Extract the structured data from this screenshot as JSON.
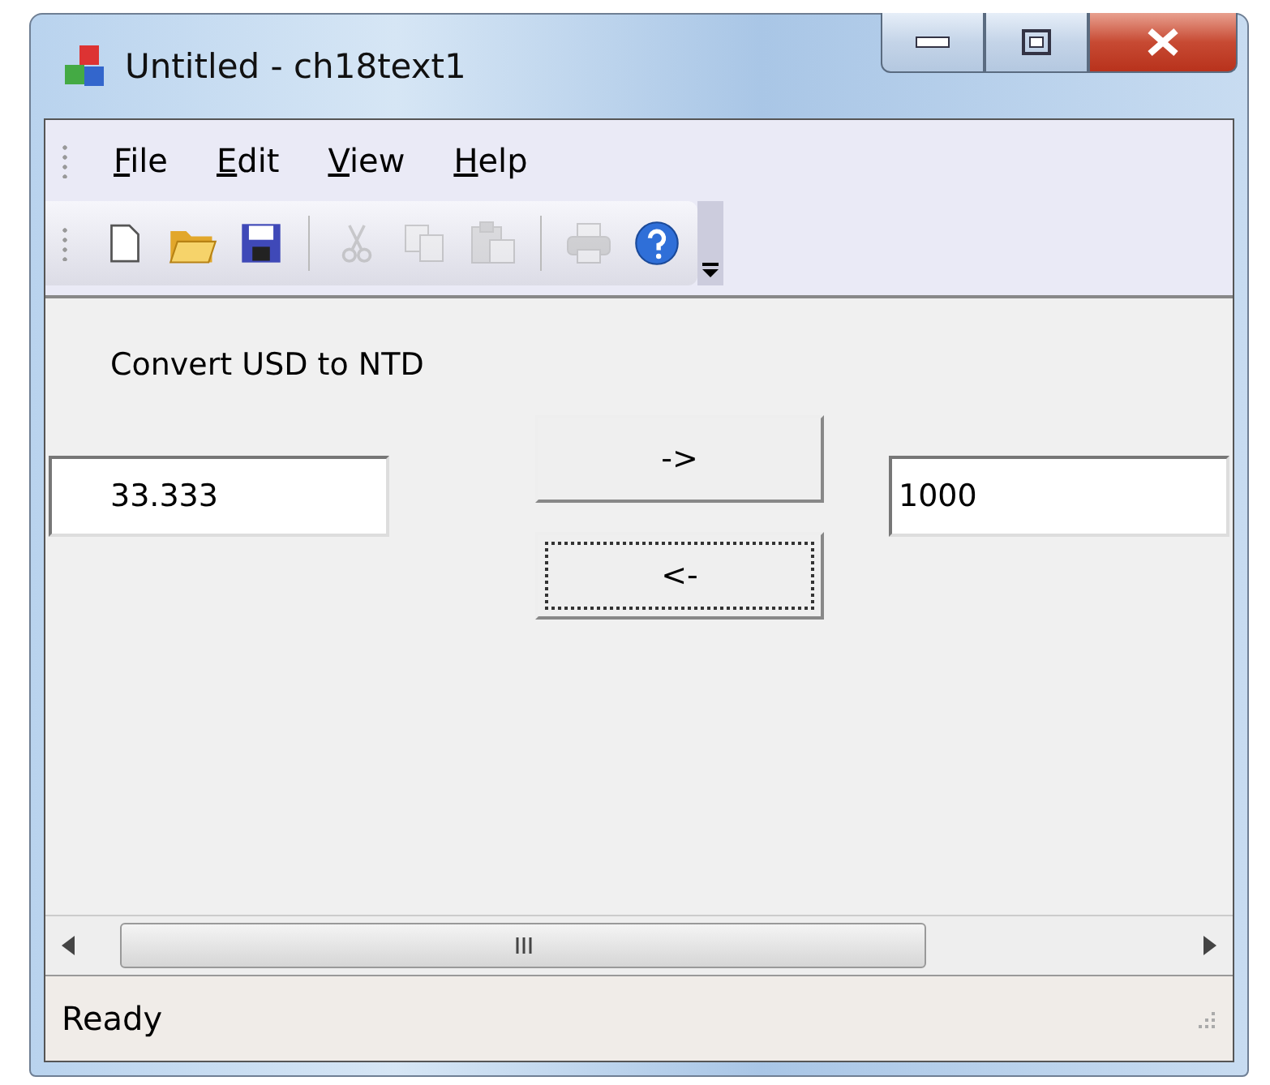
{
  "window": {
    "title": "Untitled - ch18text1"
  },
  "menu": [
    {
      "label": "File"
    },
    {
      "label": "Edit"
    },
    {
      "label": "View"
    },
    {
      "label": "Help"
    }
  ],
  "toolbar": [
    {
      "kind": "new",
      "disabled": false
    },
    {
      "kind": "open",
      "disabled": false
    },
    {
      "kind": "save",
      "disabled": false
    },
    {
      "kind": "separator"
    },
    {
      "kind": "cut",
      "disabled": true
    },
    {
      "kind": "copy",
      "disabled": true
    },
    {
      "kind": "paste",
      "disabled": true
    },
    {
      "kind": "separator"
    },
    {
      "kind": "print",
      "disabled": true
    },
    {
      "kind": "help",
      "disabled": false
    }
  ],
  "form": {
    "label": "Convert USD to NTD",
    "usd": "33.333",
    "ntd": "1000",
    "buttons": [
      {
        "label": "->",
        "focused": false
      },
      {
        "label": "<-",
        "focused": true
      }
    ]
  },
  "status_bar": "Ready"
}
